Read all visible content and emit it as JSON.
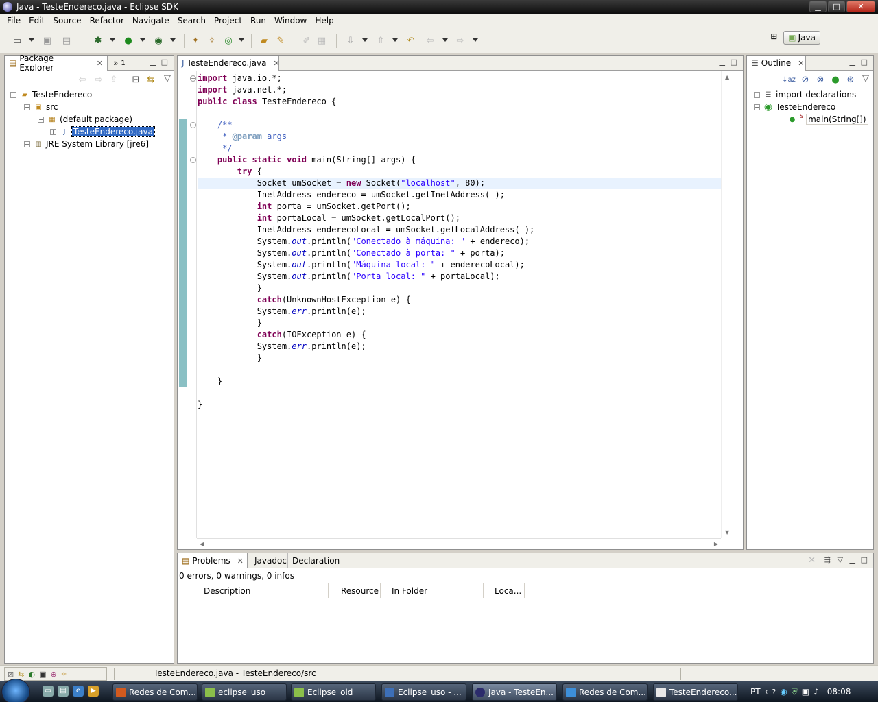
{
  "window": {
    "title": "Java - TesteEndereco.java - Eclipse SDK",
    "buttons": {
      "minimize": "▁",
      "maximize": "□",
      "close": "✕"
    }
  },
  "menu": [
    "File",
    "Edit",
    "Source",
    "Refactor",
    "Navigate",
    "Search",
    "Project",
    "Run",
    "Window",
    "Help"
  ],
  "perspective": {
    "name": "Java"
  },
  "package_explorer": {
    "tab_label": "Package Explorer",
    "overflow_count": "1",
    "tree": {
      "project": "TesteEndereco",
      "src": "src",
      "package": "(default package)",
      "file": "TesteEndereco.java",
      "library": "JRE System Library [jre6]"
    }
  },
  "editor": {
    "tab_label": "TesteEndereco.java",
    "lines": [
      "import java.io.*;",
      "import java.net.*;",
      "public class TesteEndereco {",
      "",
      "    /**",
      "     * @param args",
      "     */",
      "    public static void main(String[] args) {",
      "        try {",
      "            Socket umSocket = new Socket(\"localhost\", 80);",
      "            InetAddress endereco = umSocket.getInetAddress( );",
      "            int porta = umSocket.getPort();",
      "            int portaLocal = umSocket.getLocalPort();",
      "            InetAddress enderecoLocal = umSocket.getLocalAddress( );",
      "            System.out.println(\"Conectado à máquina: \" + endereco);",
      "            System.out.println(\"Conectado à porta: \" + porta);",
      "            System.out.println(\"Máquina local: \" + enderecoLocal);",
      "            System.out.println(\"Porta local: \" + portaLocal);",
      "            }",
      "            catch(UnknownHostException e) {",
      "            System.err.println(e);",
      "            }",
      "            catch(IOException e) {",
      "            System.err.println(e);",
      "            }",
      "",
      "    }",
      "",
      "}"
    ],
    "current_line": 9
  },
  "outline": {
    "tab_label": "Outline",
    "items": {
      "imports": "import declarations",
      "class": "TesteEndereco",
      "method": "main(String[])",
      "static_marker": "S"
    }
  },
  "bottom": {
    "tabs": [
      "Problems",
      "Javadoc",
      "Declaration"
    ],
    "summary": "0 errors, 0 warnings, 0 infos",
    "columns": [
      "Description",
      "Resource",
      "In Folder",
      "Loca..."
    ]
  },
  "status": {
    "text": "TesteEndereco.java - TesteEndereco/src"
  },
  "taskbar": {
    "tasks": [
      {
        "label": "Redes de Com...",
        "color": "#d35a1e"
      },
      {
        "label": "eclipse_uso",
        "color": "#8bbf4a"
      },
      {
        "label": "Eclipse_old",
        "color": "#8bbf4a"
      },
      {
        "label": "Eclipse_uso - ...",
        "color": "#3d6fb7"
      },
      {
        "label": "Java - TesteEn...",
        "color": "#2c2c6c"
      },
      {
        "label": "Redes de Com...",
        "color": "#3d8fd9"
      },
      {
        "label": "TesteEndereco...",
        "color": "#e8e8e8"
      }
    ],
    "tray": {
      "language": "PT",
      "time": "08:08"
    }
  }
}
